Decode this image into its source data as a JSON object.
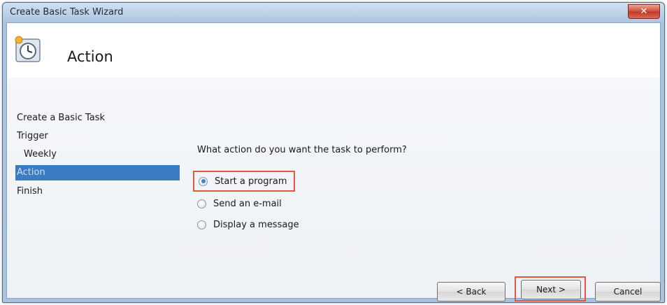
{
  "window": {
    "title": "Create Basic Task Wizard",
    "close_glyph": "✕"
  },
  "header": {
    "title": "Action",
    "icon": "clock-task-icon"
  },
  "nav": {
    "items": [
      {
        "label": "Create a Basic Task",
        "selected": false
      },
      {
        "label": "Trigger",
        "selected": false
      },
      {
        "label": "Weekly",
        "selected": false
      },
      {
        "label": "Action",
        "selected": true
      },
      {
        "label": "Finish",
        "selected": false
      }
    ]
  },
  "main": {
    "prompt": "What action do you want the task to perform?",
    "options": [
      {
        "label": "Start a program",
        "checked": true
      },
      {
        "label": "Send an e-mail",
        "checked": false
      },
      {
        "label": "Display a message",
        "checked": false
      }
    ]
  },
  "buttons": {
    "back": "< Back",
    "next": "Next >",
    "cancel": "Cancel"
  },
  "colors": {
    "selection": "#3a7bc4",
    "highlight_box": "#e05a3f"
  }
}
